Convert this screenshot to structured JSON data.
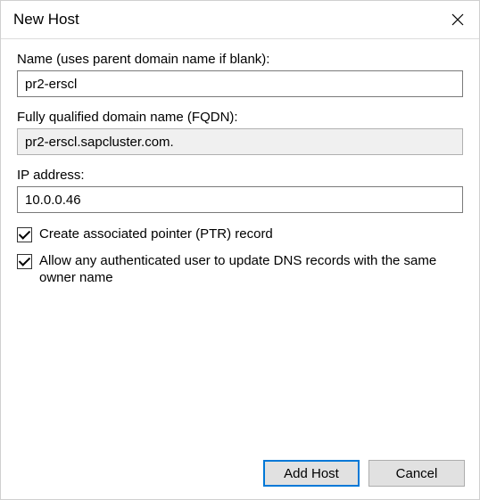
{
  "dialog": {
    "title": "New Host"
  },
  "fields": {
    "name": {
      "label": "Name (uses parent domain name if blank):",
      "value": "pr2-erscl"
    },
    "fqdn": {
      "label": "Fully qualified domain name (FQDN):",
      "value": "pr2-erscl.sapcluster.com."
    },
    "ip": {
      "label": "IP address:",
      "value": "10.0.0.46"
    }
  },
  "checkboxes": {
    "ptr": {
      "label": "Create associated pointer (PTR) record",
      "checked": true
    },
    "allowUpdate": {
      "label": "Allow any authenticated user to update DNS records with the same owner name",
      "checked": true
    }
  },
  "buttons": {
    "addHost": "Add Host",
    "cancel": "Cancel"
  }
}
